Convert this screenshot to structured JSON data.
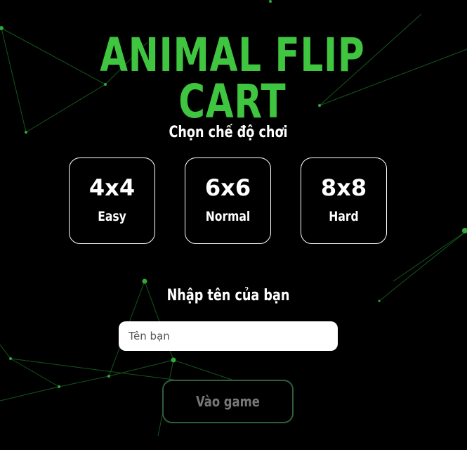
{
  "game": {
    "title": "ANIMAL FLIP CART"
  },
  "mode_select": {
    "label": "Chọn chế độ chơi",
    "modes": [
      {
        "grid": "4x4",
        "level": "Easy"
      },
      {
        "grid": "6x6",
        "level": "Normal"
      },
      {
        "grid": "8x8",
        "level": "Hard"
      }
    ]
  },
  "player": {
    "label": "Nhập tên của bạn",
    "name_value": "",
    "name_placeholder": "Tên bạn"
  },
  "actions": {
    "enter_label": "Vào game"
  },
  "colors": {
    "background": "#000000",
    "title": "#3fc53f",
    "network_line": "#1f7a2a",
    "network_node": "#2fa83a",
    "button_border": "#2f5e3a",
    "button_text": "#777777"
  }
}
